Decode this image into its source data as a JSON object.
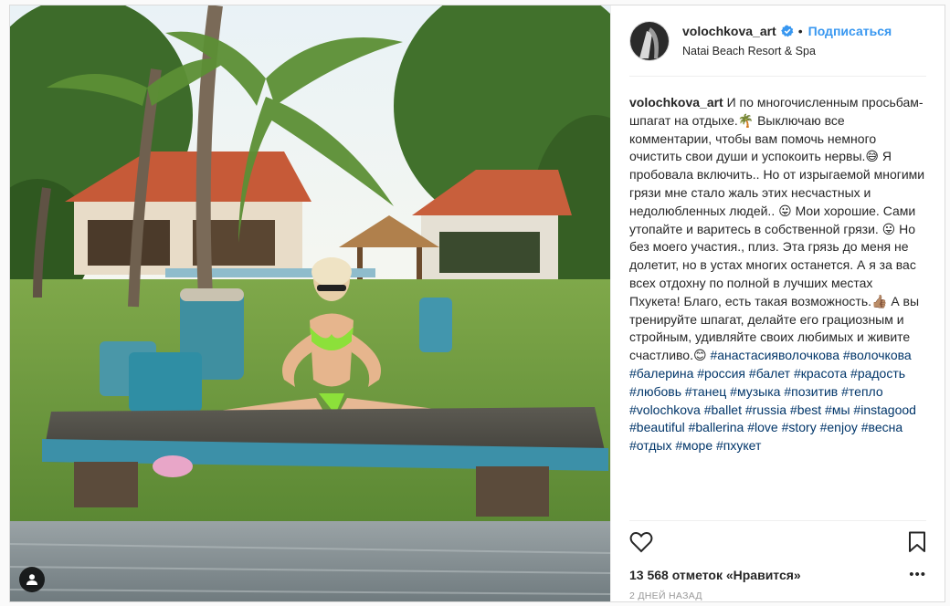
{
  "post": {
    "username": "volochkova_art",
    "follow_label": "Подписаться",
    "separator": "•",
    "location": "Natai Beach Resort & Spa",
    "caption": {
      "author": "volochkova_art",
      "text_1": " И по многочисленным просьбам-шпагат на отдыхе.🌴 Выключаю все комментарии, чтобы вам помочь немного очистить свои души и успокоить нервы.😅 Я пробовала включить.. Но от изрыгаемой многими грязи мне стало жаль этих несчастных и недолюбленных людей.. 😛 Мои хорошие. Сами утопайте и варитесь в собственной грязи. 😛 Но без моего участия., плиз. Эта грязь до меня не долетит, но в устах многих останется. А я за вас всех отдохну по полной в лучших местах Пхукета! Благо, есть такая возможность.👍🏽 А вы тренируйте шпагат, делайте его грациозным и стройным, удивляйте своих любимых и живите счастливо.😊 ",
      "tags": [
        "#анастасияволочкова",
        "#волочкова",
        "#балерина",
        "#россия",
        "#балет",
        "#красота",
        "#радость",
        "#любовь",
        "#танец",
        "#музыка",
        "#позитив",
        "#тепло",
        "#volochkova",
        "#ballet",
        "#russia",
        "#best",
        "#мы",
        "#instagood",
        "#beautiful",
        "#ballerina",
        "#love",
        "#story",
        "#enjoy",
        "#весна",
        "#отдых",
        "#море",
        "#пхукет"
      ]
    },
    "likes": "13 568 отметок «Нравится»",
    "more": "•••",
    "time": "2 ДНЕЙ НАЗАД",
    "icons": {
      "heart": "heart-icon",
      "bookmark": "bookmark-icon",
      "verified": "verified-badge-icon",
      "tag_user": "user-tag-icon"
    },
    "colors": {
      "accent": "#3897f0",
      "hashtag": "#003569",
      "meta": "#999999"
    }
  }
}
